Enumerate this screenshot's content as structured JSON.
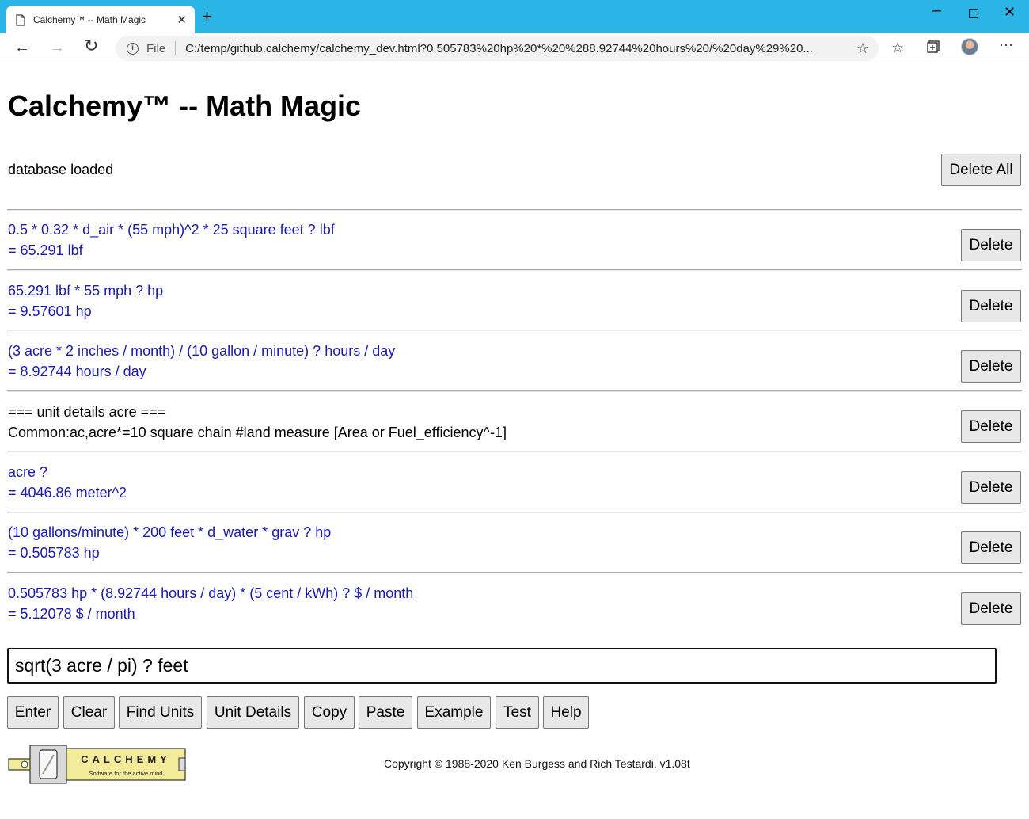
{
  "browser": {
    "tab_title": "Calchemy™ -- Math Magic",
    "tab_close": "✕",
    "new_tab": "+",
    "address_label": "File",
    "url": "C:/temp/github.calchemy/calchemy_dev.html?0.505783%20hp%20*%20%288.92744%20hours%20/%20day%29%20..."
  },
  "page": {
    "title": "Calchemy™ -- Math Magic",
    "status": "database loaded",
    "delete_all_label": "Delete All",
    "delete_label": "Delete",
    "entries": [
      {
        "query": "0.5 * 0.32 * d_air * (55 mph)^2 * 25 square feet ? lbf",
        "result": "= 65.291 lbf",
        "kind": "calc"
      },
      {
        "query": "65.291 lbf * 55 mph ? hp",
        "result": "= 9.57601 hp",
        "kind": "calc"
      },
      {
        "query": "(3 acre * 2 inches / month) / (10 gallon / minute) ? hours / day",
        "result": "= 8.92744 hours / day",
        "kind": "calc"
      },
      {
        "query": "=== unit details acre ===",
        "result": "Common:ac,acre*=10 square chain #land measure [Area or Fuel_efficiency^-1]",
        "kind": "info"
      },
      {
        "query": "acre ?",
        "result": "= 4046.86 meter^2",
        "kind": "calc"
      },
      {
        "query": "(10 gallons/minute) * 200 feet * d_water * grav ? hp",
        "result": "= 0.505783 hp",
        "kind": "calc"
      },
      {
        "query": "0.505783 hp * (8.92744 hours / day) * (5 cent / kWh) ? $ / month",
        "result": "= 5.12078 $ / month",
        "kind": "calc"
      }
    ],
    "input_value": "sqrt(3 acre / pi) ? feet",
    "buttons": {
      "enter": "Enter",
      "clear": "Clear",
      "find_units": "Find Units",
      "unit_details": "Unit Details",
      "copy": "Copy",
      "paste": "Paste",
      "example": "Example",
      "test": "Test",
      "help": "Help"
    },
    "logo_text": "CALCHEMY",
    "logo_tagline": "Software for the active mind",
    "copyright": "Copyright © 1988-2020 Ken Burgess and Rich Testardi. v1.08t"
  },
  "colors": {
    "titlebar": "#2bb5e6",
    "query_text": "#1a1ab0",
    "button_bg": "#e8e8e8"
  }
}
